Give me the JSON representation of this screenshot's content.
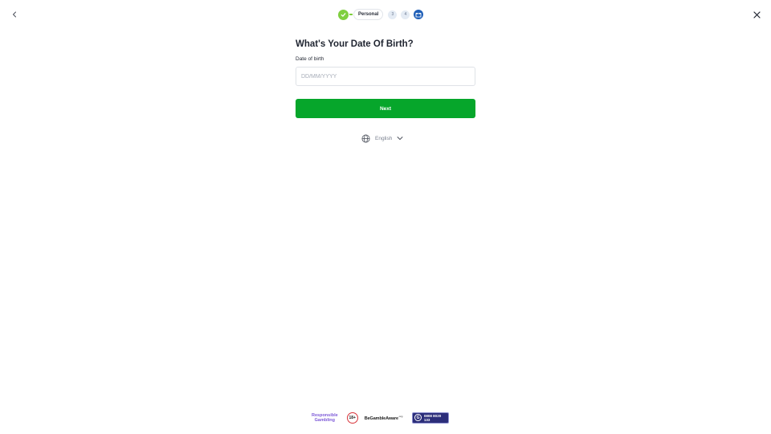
{
  "header": {
    "back_icon": "chevron-left-icon",
    "close_icon": "close-icon"
  },
  "stepper": {
    "done_icon": "check-icon",
    "current_label": "Personal",
    "pending_steps": [
      "3",
      "4"
    ],
    "final_icon": "gift-icon",
    "colors": {
      "done": "#7fcf3f",
      "pending": "#e4ebf4",
      "final": "#1f5fb8"
    }
  },
  "form": {
    "title": "What's Your Date Of Birth?",
    "dob_label": "Date of birth",
    "dob_value": "",
    "dob_placeholder": "DD/MM/YYYY",
    "next_label": "Next"
  },
  "language": {
    "icon": "globe-icon",
    "label": "English",
    "chevron_icon": "chevron-down-icon"
  },
  "footer": {
    "responsible_line1": "Responsible",
    "responsible_line2": "Gambling",
    "age_badge": "18+",
    "begambleaware": "BeGambleAware",
    "begambleaware_suffix": ".org",
    "gamstop_phone": "0808 8020 133"
  },
  "colors": {
    "primary_button": "#06a62b",
    "brand_purple": "#7e5bd8",
    "age_red": "#d8333a",
    "gamstop_navy": "#2c2e7a"
  }
}
